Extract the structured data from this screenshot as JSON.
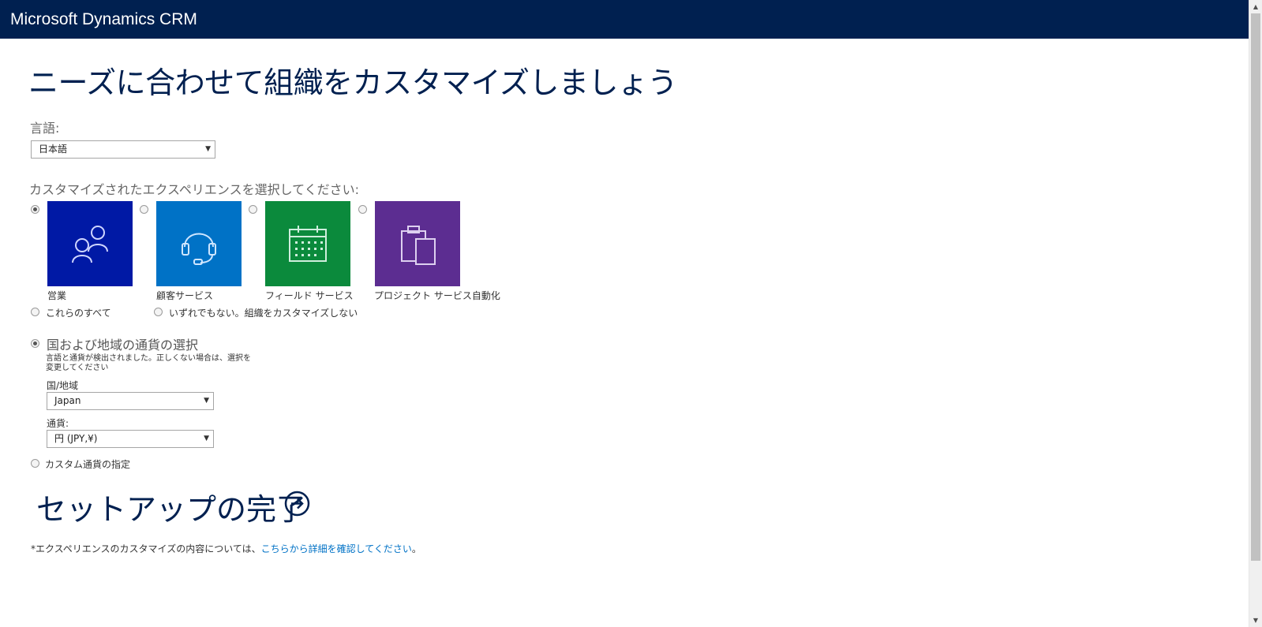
{
  "app": {
    "title": "Microsoft Dynamics CRM"
  },
  "page": {
    "heading": "ニーズに合わせて組織をカスタマイズしましょう"
  },
  "language": {
    "label": "言語:",
    "selected": "日本語"
  },
  "experience": {
    "label": "カスタマイズされたエクスペリエンスを選択してください:",
    "tiles": [
      {
        "label": "営業",
        "icon": "people-icon",
        "color": "#0019a5",
        "checked": true
      },
      {
        "label": "顧客サービス",
        "icon": "headset-icon",
        "color": "#0072c6",
        "checked": false
      },
      {
        "label": "フィールド サービス",
        "icon": "calendar-icon",
        "color": "#0b8a3c",
        "checked": false
      },
      {
        "label": "プロジェクト サービス自動化",
        "icon": "clipboard-icon",
        "color": "#5c2d91",
        "checked": false
      }
    ],
    "all_label": "これらのすべて",
    "none_label": "いずれでもない。組織をカスタマイズしない"
  },
  "currency": {
    "option_label": "国および地域の通貨の選択",
    "description": "言語と通貨が検出されました。正しくない場合は、選択を変更してください",
    "country_label": "国/地域",
    "country_value": "Japan",
    "currency_label": "通貨:",
    "currency_value": "円 (JPY,¥)",
    "custom_label": "カスタム通貨の指定"
  },
  "cta": {
    "label": "セットアップの完了"
  },
  "footnote": {
    "prefix": "*エクスペリエンスのカスタマイズの内容については、",
    "link": "こちらから詳細を確認してください",
    "suffix": "。"
  },
  "colors": {
    "header": "#002050",
    "link": "#0072c6"
  }
}
